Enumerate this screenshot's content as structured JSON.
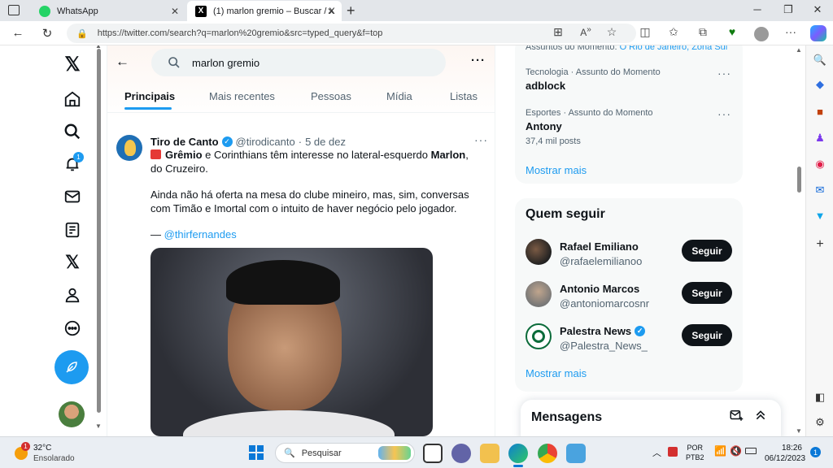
{
  "browser": {
    "tabs": [
      {
        "title": "WhatsApp",
        "icon": "whatsapp-icon"
      },
      {
        "title": "(1) marlon gremio – Buscar / X",
        "icon": "x-logo-icon"
      }
    ],
    "url": "https://twitter.com/search?q=marlon%20gremio&src=typed_query&f=top"
  },
  "nav": {
    "notif_badge": "1"
  },
  "search": {
    "query": "marlon gremio"
  },
  "tabs": [
    "Principais",
    "Mais recentes",
    "Pessoas",
    "Mídia",
    "Listas"
  ],
  "tweet": {
    "author": "Tiro de Canto",
    "handle": "@tirodicanto",
    "sep": "·",
    "date": "5 de dez",
    "p1_a": "Grêmio",
    "p1_b": " e Corinthians têm interesse no lateral-esquerdo ",
    "p1_c": "Marlon",
    "p1_d": ", do Cruzeiro.",
    "p2": "Ainda não há oferta na mesa do clube mineiro, mas, sim, conversas com Timão e Imortal com o intuito de haver negócio pelo jogador.",
    "credit_dash": "— ",
    "credit_link": "@thirfernandes"
  },
  "trends": {
    "top_partial": "Assuntos do Momento: ",
    "top_partial_link": "O Rio de Janeiro, Zona Sul",
    "items": [
      {
        "category": "Tecnologia · Assunto do Momento",
        "name": "adblock",
        "posts": ""
      },
      {
        "category": "Esportes · Assunto do Momento",
        "name": "Antony",
        "posts": "37,4 mil posts"
      }
    ],
    "show_more": "Mostrar mais"
  },
  "who_to_follow": {
    "title": "Quem seguir",
    "people": [
      {
        "name": "Rafael Emiliano",
        "handle": "@rafaelemilianoo",
        "verified": false,
        "button": "Seguir"
      },
      {
        "name": "Antonio Marcos",
        "handle": "@antoniomarcosnr",
        "verified": false,
        "button": "Seguir"
      },
      {
        "name": "Palestra News",
        "handle": "@Palestra_News_",
        "verified": true,
        "button": "Seguir"
      }
    ],
    "show_more": "Mostrar mais"
  },
  "messages": {
    "title": "Mensagens"
  },
  "taskbar": {
    "weather_temp": "32°C",
    "weather_desc": "Ensolarado",
    "weather_badge": "1",
    "search_placeholder": "Pesquisar",
    "lang_1": "POR",
    "lang_2": "PTB2",
    "time": "18:26",
    "date": "06/12/2023",
    "notif": "1"
  },
  "colors": {
    "x_blue": "#1d9bf0",
    "text": "#0f1419",
    "muted": "#536471"
  }
}
